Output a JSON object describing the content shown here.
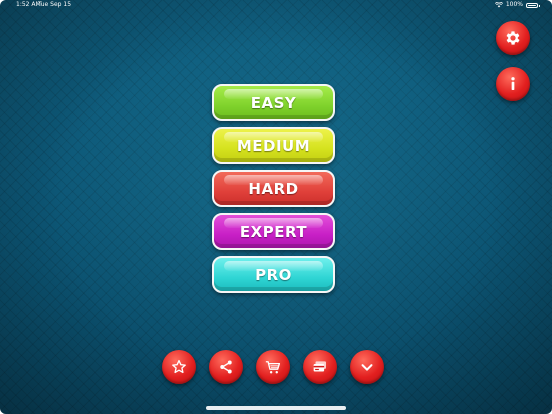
{
  "status_bar": {
    "time": "1:52 AM",
    "date": "Tue Sep 15",
    "battery": "100%",
    "wifi_icon": "wifi-icon",
    "battery_icon": "battery-icon"
  },
  "difficulty_menu": {
    "buttons": [
      {
        "label": "EASY",
        "color": "#7fd22c"
      },
      {
        "label": "MEDIUM",
        "color": "#d5e21e"
      },
      {
        "label": "HARD",
        "color": "#e0403a"
      },
      {
        "label": "EXPERT",
        "color": "#c81fc6"
      },
      {
        "label": "PRO",
        "color": "#2fd5d4"
      }
    ]
  },
  "side_actions": [
    {
      "icon": "gear-icon"
    },
    {
      "icon": "info-icon"
    }
  ],
  "bottom_actions": [
    {
      "icon": "star-icon"
    },
    {
      "icon": "share-icon"
    },
    {
      "icon": "cart-icon"
    },
    {
      "icon": "card-icon"
    },
    {
      "icon": "chevron-down-icon"
    }
  ],
  "colors": {
    "background": "#0c5574",
    "action_button": "#e21f1f"
  }
}
